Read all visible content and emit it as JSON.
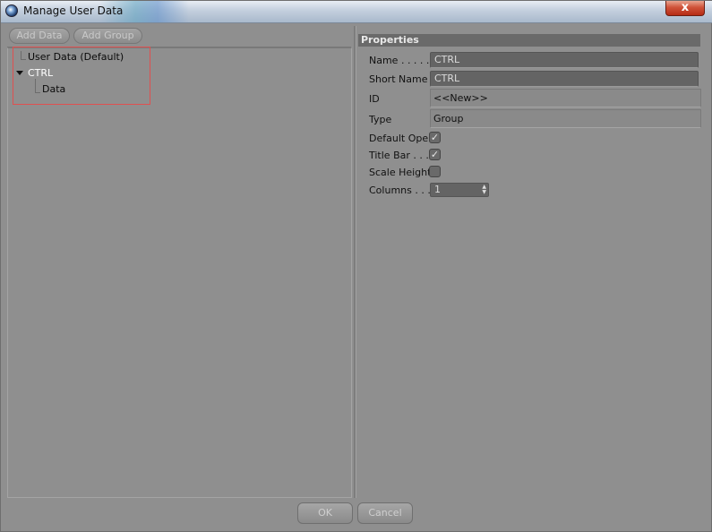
{
  "window": {
    "title": "Manage User Data",
    "close_label": "x"
  },
  "toolbar": {
    "add_data_label": "Add Data",
    "add_group_label": "Add Group"
  },
  "tree": {
    "items": [
      {
        "label": "User Data (Default)",
        "level": 0
      },
      {
        "label": "CTRL",
        "level": 0,
        "expanded": true
      },
      {
        "label": "Data",
        "level": 1
      }
    ]
  },
  "properties": {
    "header": "Properties",
    "name_label": "Name . . . . . .",
    "name_value": "CTRL",
    "short_name_label": "Short Name",
    "short_name_value": "CTRL",
    "id_label": "ID",
    "id_value": "<<New>>",
    "type_label": "Type",
    "type_value": "Group",
    "default_open_label": "Default Open",
    "default_open_checked": true,
    "title_bar_label": "Title Bar . . . .",
    "title_bar_checked": true,
    "scale_height_label": "Scale Height",
    "scale_height_checked": false,
    "columns_label": "Columns . . . .",
    "columns_value": "1"
  },
  "footer": {
    "ok_label": "OK",
    "cancel_label": "Cancel"
  },
  "colors": {
    "panel_bg": "#8f8f8f",
    "field_dark": "#646464",
    "header_bg": "#6a6a6a",
    "selection_outline": "#e05050",
    "tree_selected_text": "#ffffff"
  },
  "icons": {
    "app": "cinema4d-app-icon",
    "check": "checkmark-icon",
    "stepper": "up-down-arrows-icon",
    "expand": "triangle-down-icon"
  }
}
